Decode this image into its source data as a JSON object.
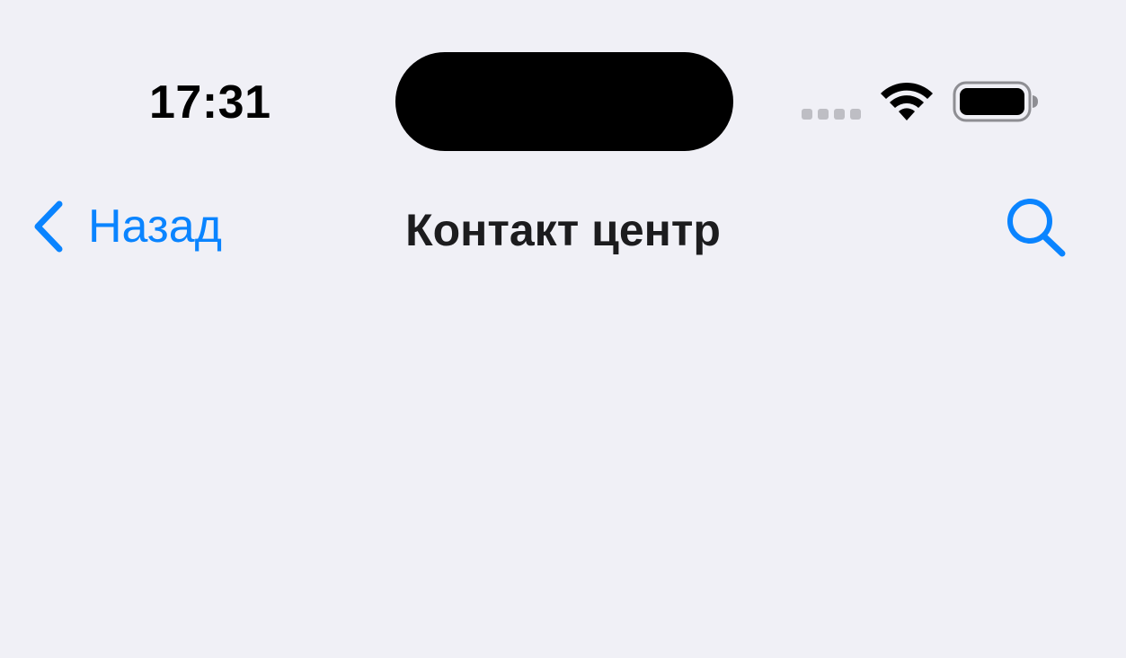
{
  "status_bar": {
    "time": "17:31",
    "cellular_icon": "signal-dots-icon",
    "wifi_icon": "wifi-icon",
    "battery_icon": "battery-icon"
  },
  "nav_bar": {
    "back_label": "Назад",
    "back_icon": "chevron-left-icon",
    "title": "Контакт центр",
    "search_icon": "search-icon"
  },
  "colors": {
    "background": "#F0F0F6",
    "accent": "#0A84FF",
    "title": "#1C1C1E"
  }
}
